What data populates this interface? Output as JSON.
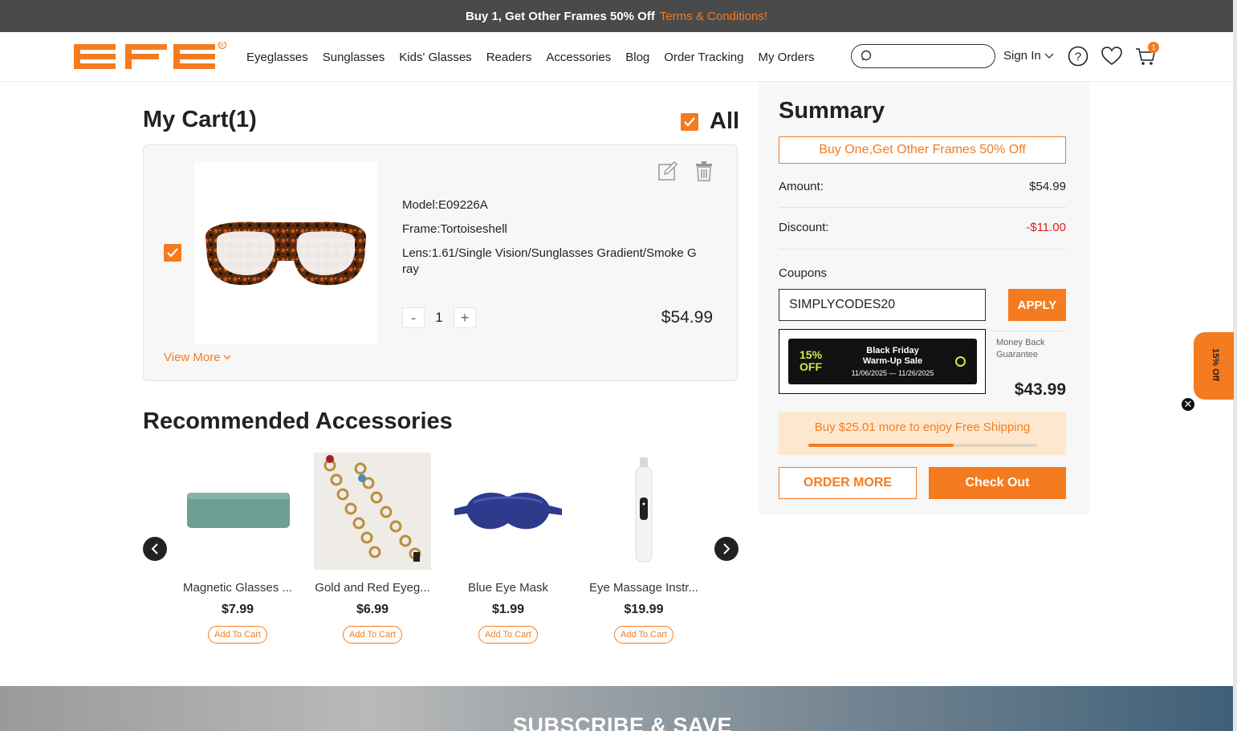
{
  "promo_bar": {
    "text": "Buy 1, Get Other Frames 50% Off",
    "link": "Terms & Conditions!"
  },
  "header": {
    "nav": [
      "Eyeglasses",
      "Sunglasses",
      "Kids' Glasses",
      "Readers",
      "Accessories",
      "Blog",
      "Order Tracking",
      "My Orders"
    ],
    "search_placeholder": "",
    "signin": "Sign In",
    "cart_count": "1"
  },
  "cart": {
    "title": "My Cart(1)",
    "select_all": "All",
    "item": {
      "model": "Model:E09226A",
      "frame": "Frame:Tortoiseshell",
      "lens": "Lens:1.61/Single Vision/Sunglasses Gradient/Smoke G ray",
      "qty": "1",
      "qty_minus": "-",
      "qty_plus": "+",
      "price": "$54.99",
      "view_more": "View More"
    }
  },
  "recommended": {
    "title": "Recommended Accessories",
    "items": [
      {
        "name": "Magnetic Glasses ...",
        "price": "$7.99",
        "cta": "Add To Cart"
      },
      {
        "name": "Gold and Red Eyeg...",
        "price": "$6.99",
        "cta": "Add To Cart"
      },
      {
        "name": "Blue Eye Mask",
        "price": "$1.99",
        "cta": "Add To Cart"
      },
      {
        "name": "Eye Massage Instr...",
        "price": "$19.99",
        "cta": "Add To Cart"
      }
    ]
  },
  "summary": {
    "title": "Summary",
    "promo": "Buy One,Get Other Frames 50% Off",
    "amount_label": "Amount:",
    "amount_value": "$54.99",
    "discount_label": "Discount:",
    "discount_value": "-$11.00",
    "coupons_label": "Coupons",
    "coupon_code": "SIMPLYCODES20",
    "apply": "APPLY",
    "money_back": "Money Back",
    "guarantee": "Guarantee",
    "total_value": "$43.99",
    "shipping_text": "Buy $25.01 more to enjoy Free Shipping",
    "shipping_progress": 0.635,
    "order_more": "ORDER MORE",
    "checkout": "Check Out"
  },
  "coupon_popup": {
    "off_line1": "15%",
    "off_line2": "OFF",
    "title_line1": "Black Friday",
    "title_line2": "Warm-Up Sale",
    "dates": "11/06/2025 — 11/26/2025"
  },
  "side_tab": {
    "text": "15% Off"
  },
  "footer": {
    "subscribe": "SUBSCRIBE & SAVE"
  },
  "colors": {
    "accent": "#f47b20",
    "discount": "#e02020",
    "topbar": "#4a4a4a"
  }
}
